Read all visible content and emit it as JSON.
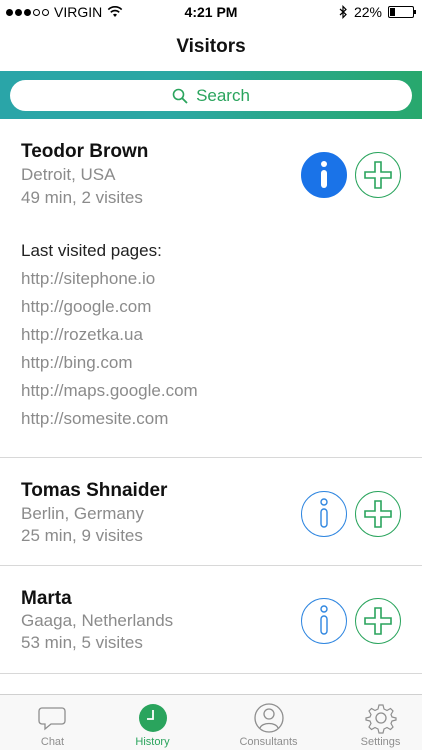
{
  "status_bar": {
    "carrier": "VIRGIN",
    "time": "4:21 PM",
    "battery": "22%",
    "battery_level": 0.22
  },
  "nav": {
    "title": "Visitors"
  },
  "search": {
    "label": "Search"
  },
  "visitors": [
    {
      "name": "Teodor Brown",
      "location": "Detroit, USA",
      "stats": "49 min, 2 visites",
      "pages_title": "Last visited pages:",
      "pages": [
        "http://sitephone.io",
        "http://google.com",
        "http://rozetka.ua",
        "http://bing.com",
        "http://maps.google.com",
        "http://somesite.com"
      ]
    },
    {
      "name": "Tomas Shnaider",
      "location": "Berlin, Germany",
      "stats": "25 min, 9 visites"
    },
    {
      "name": "Marta",
      "location": "Gaaga, Netherlands",
      "stats": "53 min, 5 visites"
    }
  ],
  "tabs": [
    {
      "label": "Chat",
      "icon": "chat-bubble-icon"
    },
    {
      "label": "History",
      "icon": "clock-icon"
    },
    {
      "label": "Consultants",
      "icon": "person-icon"
    },
    {
      "label": "Settings",
      "icon": "gear-icon"
    }
  ],
  "colors": {
    "accent_green": "#2aa45d",
    "info_blue": "#1a73e8",
    "band_teal": "#2aa5a8"
  }
}
